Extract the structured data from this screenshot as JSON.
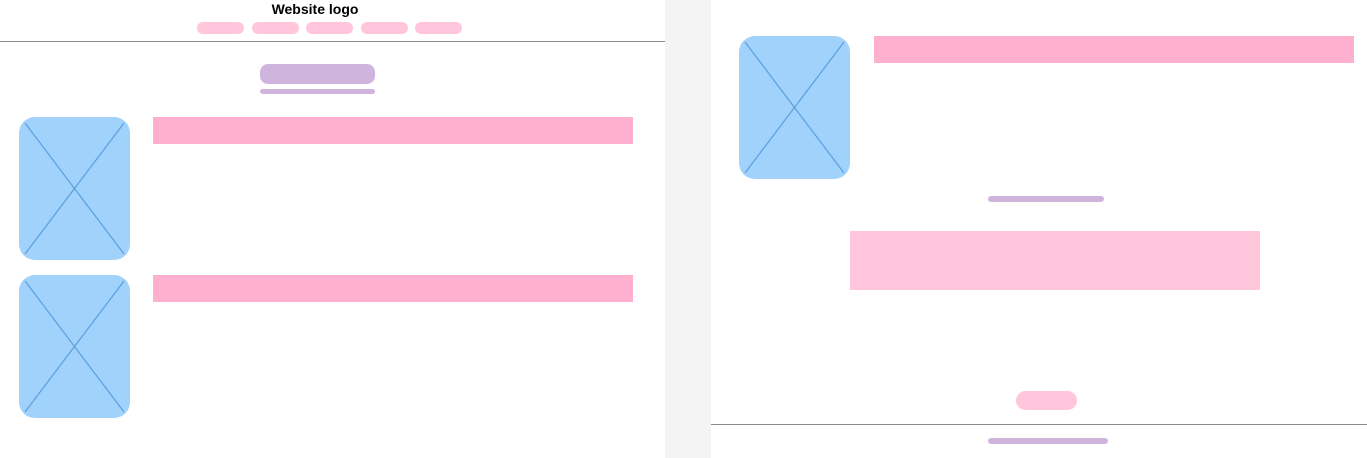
{
  "header": {
    "logo_text": "Website logo",
    "nav_item_count": 5
  },
  "colors": {
    "image_placeholder": "#a0d2fc",
    "image_cross": "#5a9fe0",
    "heading_bar": "#ffb0cf",
    "light_pink": "#ffc6dc",
    "purple": "#cfb5de",
    "divider": "#8a8a8a",
    "canvas": "#f4f4f4"
  },
  "icons": {
    "image": "image-placeholder-icon"
  }
}
